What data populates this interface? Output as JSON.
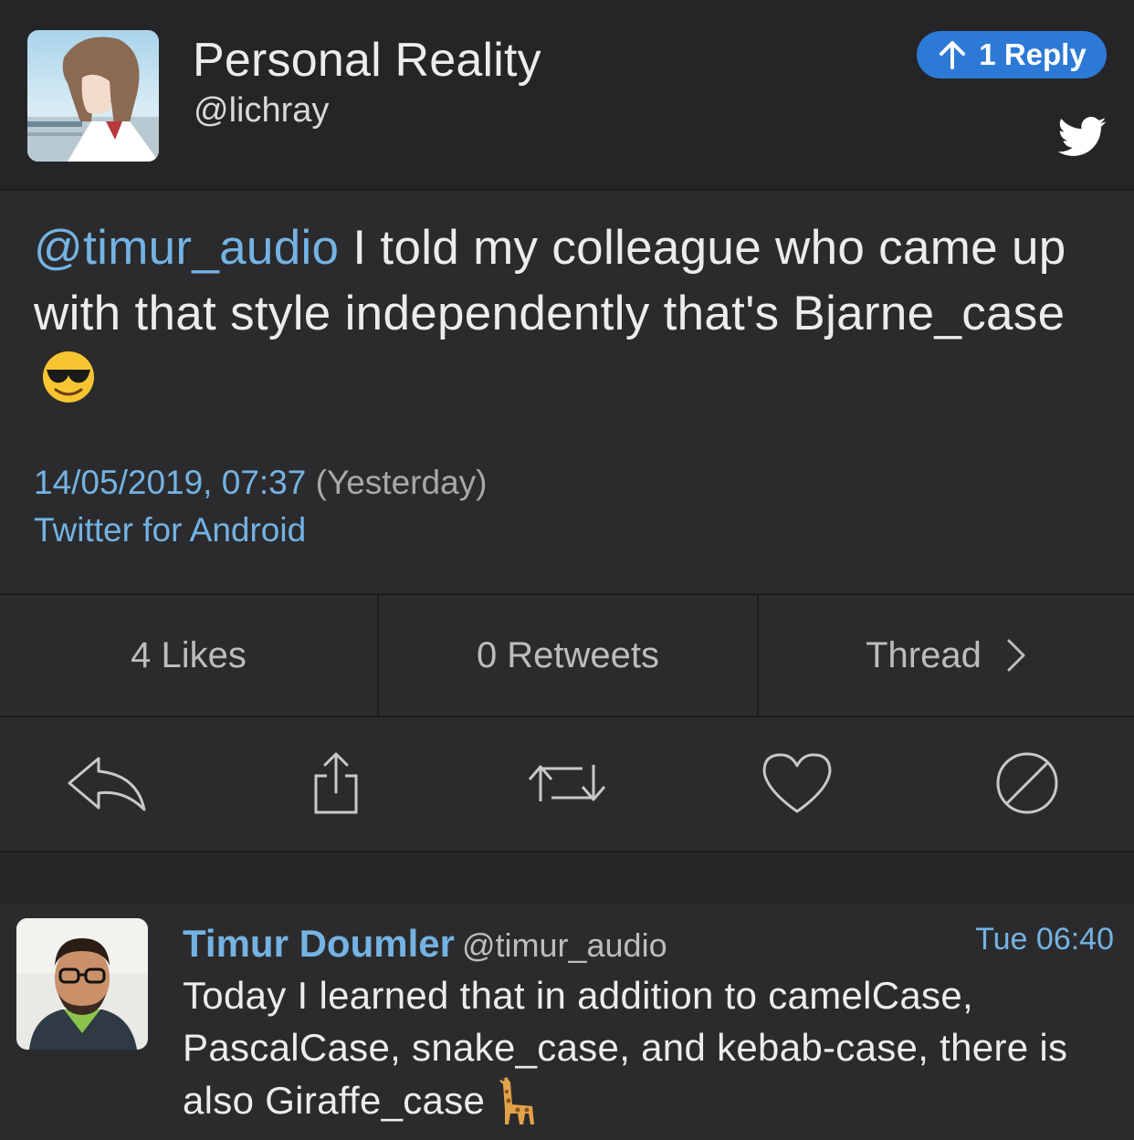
{
  "header": {
    "display_name": "Personal Reality",
    "handle": "@lichray",
    "reply_button_label": "1 Reply",
    "icons": [
      "avatar",
      "arrow-up-icon",
      "twitter-bird-icon"
    ]
  },
  "tweet": {
    "mention": "@timur_audio",
    "text": " I told my colleague who came up with that style independently that's Bjarne_case",
    "emoji": "smiling-face-with-sunglasses",
    "timestamp": "14/05/2019, 07:37",
    "relative_time": "(Yesterday)",
    "source": "Twitter for Android"
  },
  "stats": {
    "likes": "4 Likes",
    "retweets": "0 Retweets",
    "thread": "Thread"
  },
  "actions": {
    "icons": [
      "reply-icon",
      "share-icon",
      "retweet-icon",
      "like-icon",
      "mute-icon"
    ]
  },
  "parent_tweet": {
    "name": "Timur Doumler",
    "handle": "@timur_audio",
    "time": "Tue 06:40",
    "text": "Today I learned that in addition to camelCase, PascalCase, snake_case, and kebab-case, there is also Giraffe_case",
    "emoji": "giraffe"
  },
  "colors": {
    "background": "#2b2b2d",
    "header_background": "#252527",
    "accent": "#74b3e3",
    "reply_button": "#2c7ad6",
    "icon_gray": "#c8c8c8"
  }
}
